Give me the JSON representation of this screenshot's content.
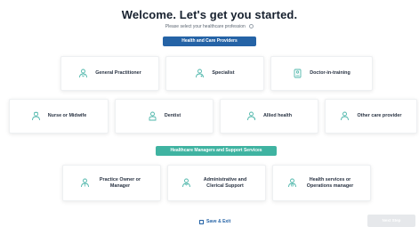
{
  "header": {
    "title": "Welcome. Let's get you started.",
    "subtitle": "Please select your healthcare profession"
  },
  "sections": {
    "providers_label": "Health and Care Providers",
    "managers_label": "Healthcare Managers and Support Services"
  },
  "providers": [
    {
      "label": "General Practitioner",
      "icon": "doctor-icon"
    },
    {
      "label": "Specialist",
      "icon": "specialist-icon"
    },
    {
      "label": "Doctor-in-training",
      "icon": "trainee-doctor-icon"
    },
    {
      "label": "Nurse or Midwife",
      "icon": "nurse-icon"
    },
    {
      "label": "Dentist",
      "icon": "dentist-icon"
    },
    {
      "label": "Allied health",
      "icon": "allied-health-icon"
    },
    {
      "label": "Other care provider",
      "icon": "care-provider-icon"
    }
  ],
  "managers": [
    {
      "label": "Practice Owner or Manager",
      "icon": "manager-icon"
    },
    {
      "label": "Administrative and Clerical Support",
      "icon": "admin-icon"
    },
    {
      "label": "Health services or Operations manager",
      "icon": "operations-icon"
    }
  ],
  "footer": {
    "save_label": "Save & Exit",
    "next_label": "Next Step"
  },
  "colors": {
    "accent_blue": "#2563a6",
    "accent_teal": "#3fb3a1",
    "icon_teal": "#4fb7ab"
  }
}
